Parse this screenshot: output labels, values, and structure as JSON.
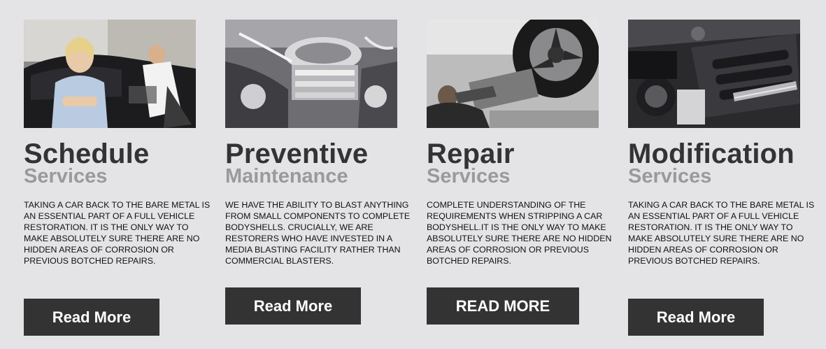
{
  "cards": [
    {
      "title": "Schedule",
      "subtitle": "Services",
      "description": "TAKING A CAR BACK TO THE BARE METAL IS AN ESSENTIAL PART OF A FULL VEHICLE RESTORATION. IT IS THE ONLY WAY TO MAKE ABSOLUTELY SURE THERE ARE NO HIDDEN AREAS OF CORROSION OR PREVIOUS BOTCHED REPAIRS.",
      "button": "Read More"
    },
    {
      "title": "Preventive",
      "subtitle": "Maintenance",
      "description": "WE HAVE THE ABILITY TO BLAST ANYTHING FROM SMALL COMPONENTS TO COMPLETE BODYSHELLS. CRUCIALLY, WE ARE RESTORERS WHO HAVE INVESTED IN A MEDIA BLASTING FACILITY RATHER THAN COMMERCIAL BLASTERS.",
      "button": "Read More"
    },
    {
      "title": "Repair",
      "subtitle": "Services",
      "description": "COMPLETE UNDERSTANDING OF THE REQUIREMENTS WHEN STRIPPING A CAR BODYSHELL.IT IS THE ONLY WAY TO MAKE ABSOLUTELY SURE THERE ARE NO HIDDEN AREAS OF CORROSION OR PREVIOUS BOTCHED REPAIRS.",
      "button": "READ MORE"
    },
    {
      "title": "Modification",
      "subtitle": "Services",
      "description": "TAKING A CAR BACK TO THE BARE METAL IS AN ESSENTIAL PART OF A FULL VEHICLE RESTORATION. IT IS THE ONLY WAY TO MAKE ABSOLUTELY SURE THERE ARE NO HIDDEN AREAS OF CORROSION OR PREVIOUS BOTCHED REPAIRS.",
      "button": "Read More"
    }
  ],
  "colors": {
    "background": "#e4e4e6",
    "title": "#333333",
    "subtitle": "#9a9a9e",
    "button_bg": "#333333",
    "button_text": "#ffffff"
  }
}
